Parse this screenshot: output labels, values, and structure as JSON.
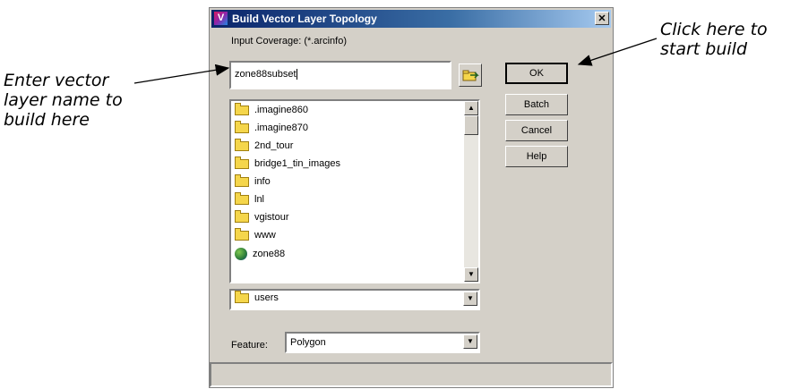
{
  "dialog": {
    "title": "Build Vector Layer Topology",
    "close_glyph": "✕",
    "input_label": "Input Coverage: (*.arcinfo)",
    "input_value": "zone88subset",
    "browse_icon": "folder-browse-icon",
    "files": [
      {
        "name": ".imagine860",
        "icon": "folder-icon"
      },
      {
        "name": ".imagine870",
        "icon": "folder-icon"
      },
      {
        "name": "2nd_tour",
        "icon": "folder-icon"
      },
      {
        "name": "bridge1_tin_images",
        "icon": "folder-icon"
      },
      {
        "name": "info",
        "icon": "folder-icon"
      },
      {
        "name": "lnl",
        "icon": "folder-icon"
      },
      {
        "name": "vgistour",
        "icon": "folder-icon"
      },
      {
        "name": "www",
        "icon": "folder-icon"
      },
      {
        "name": "zone88",
        "icon": "coverage-icon"
      }
    ],
    "directory": "users",
    "feature_label": "Feature:",
    "feature_value": "Polygon",
    "buttons": {
      "ok": "OK",
      "batch": "Batch",
      "cancel": "Cancel",
      "help": "Help"
    },
    "scroll_up_glyph": "▲",
    "scroll_down_glyph": "▼",
    "dropdown_glyph": "▼"
  },
  "annotations": {
    "enter_name_line1": "Enter vector",
    "enter_name_line2": "layer name to",
    "enter_name_line3": "build here",
    "click_build_line1": "Click here to",
    "click_build_line2": "start build"
  }
}
